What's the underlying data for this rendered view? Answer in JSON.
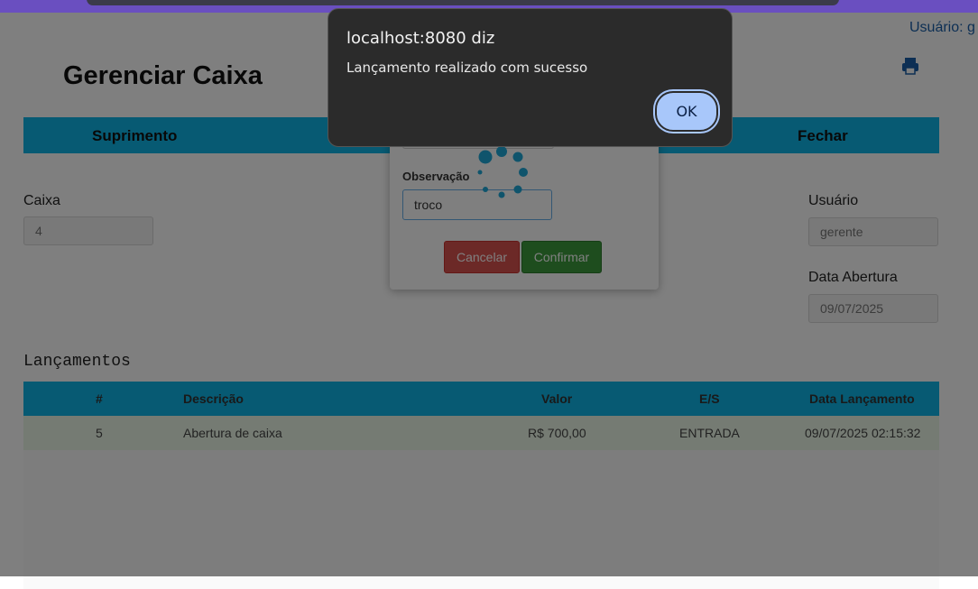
{
  "browser": {
    "accent": "#6a4fc0"
  },
  "header": {
    "user_label": "Usuário: g",
    "title": "Gerenciar Caixa",
    "print_icon": "print-icon"
  },
  "actions": {
    "suprimento": "Suprimento",
    "fechar": "Fechar"
  },
  "form": {
    "caixa_label": "Caixa",
    "caixa_value": "4",
    "usuario_label": "Usuário",
    "usuario_value": "gerente",
    "abertura_label": "Data Abertura",
    "abertura_value": "09/07/2025"
  },
  "lancamentos": {
    "title": "Lançamentos",
    "columns": [
      "#",
      "Descrição",
      "Valor",
      "E/S",
      "Data Lançamento"
    ],
    "rows": [
      {
        "id": "5",
        "descricao": "Abertura de caixa",
        "valor": "R$ 700,00",
        "es": "ENTRADA",
        "data": "09/07/2025 02:15:32"
      }
    ]
  },
  "modal": {
    "obs_label": "Observação",
    "obs_value": "troco",
    "cancel": "Cancelar",
    "confirm": "Confirmar"
  },
  "alert": {
    "host": "localhost:8080 diz",
    "message": "Lançamento realizado com sucesso",
    "ok": "OK"
  },
  "colors": {
    "primary": "#0fb4e6",
    "row_bg": "#eaf7e6",
    "cancel": "#d9534f",
    "confirm": "#3c9b3c",
    "alert_button": "#a8c7fa"
  }
}
